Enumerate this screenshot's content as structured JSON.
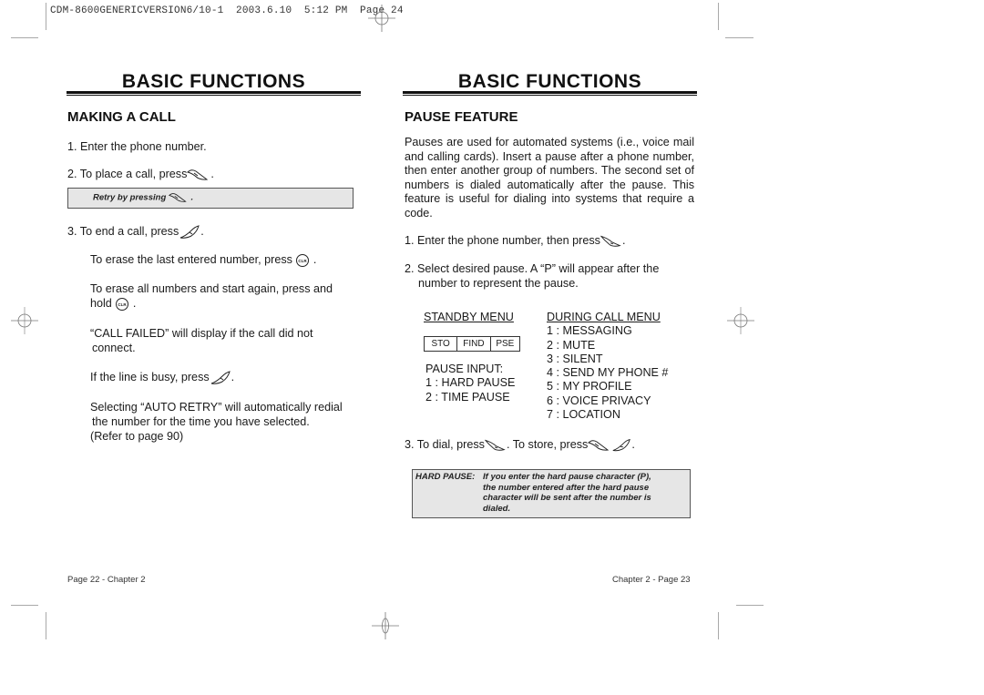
{
  "slug": "CDM-8600GENERICVERSION6/10-1  2003.6.10  5:12 PM  Page 24",
  "left_page": {
    "title": "BASIC FUNCTIONS",
    "section_heading": "MAKING A CALL",
    "step1": "1. Enter the phone number.",
    "step2": "2. To place a call, press",
    "step2_end": ".",
    "note_text": "Retry by pressing",
    "note_end": ".",
    "step3": "3. To end a call, press",
    "step3_end": ".",
    "erase_last": "To erase the last entered number, press",
    "erase_last_end": ".",
    "erase_all_line1": "To erase all numbers and start again, press and",
    "erase_all_line2": "hold",
    "erase_all_end": ".",
    "call_failed_line1": "“CALL FAILED” will display if the call did not",
    "call_failed_line2": "connect.",
    "busy": "If the line is busy, press",
    "busy_end": ".",
    "auto_retry_line1": "Selecting “AUTO RETRY” will automatically redial",
    "auto_retry_line2": "the number for the time you have selected.",
    "auto_retry_line3": "(Refer to page 90)",
    "footer": "Page 22 - Chapter 2"
  },
  "right_page": {
    "title": "BASIC FUNCTIONS",
    "section_heading": "PAUSE FEATURE",
    "intro": "Pauses are used for automated systems (i.e., voice mail and calling cards). Insert a pause after a phone number, then enter another group of numbers. The second set of numbers is dialed automatically after the pause. This feature is useful for dialing into systems that require a code.",
    "step1": "1. Enter the phone number, then press",
    "step1_end": ".",
    "step2_line1": "2. Select desired pause. A “P” will appear after the",
    "step2_line2": "number to represent the pause.",
    "standby_menu": {
      "heading": "STANDBY MENU",
      "softkeys": [
        "STO",
        "FIND",
        "PSE"
      ],
      "pause_input_label": "PAUSE INPUT:",
      "options": [
        "1 : HARD PAUSE",
        "2 : TIME PAUSE"
      ]
    },
    "during_call_menu": {
      "heading": "DURING CALL MENU",
      "items": [
        "1 : MESSAGING",
        "2 : MUTE",
        "3 : SILENT",
        "4 : SEND MY PHONE #",
        "5 : MY PROFILE",
        "6 : VOICE PRIVACY",
        "7 : LOCATION"
      ]
    },
    "step3_a": "3. To dial, press",
    "step3_b": ". To store, press",
    "step3_end": ".",
    "note_label": "HARD PAUSE:",
    "note_lines": [
      "If you enter the hard pause character (P),",
      "the number entered after the hard pause",
      "character will be sent after the number is",
      "dialed."
    ],
    "footer": "Chapter 2 - Page 23"
  },
  "icons": {
    "send_key": "send-key-icon",
    "end_key": "end-key-icon",
    "clr_key": "clr-key-icon",
    "clr_label": "CLR"
  }
}
